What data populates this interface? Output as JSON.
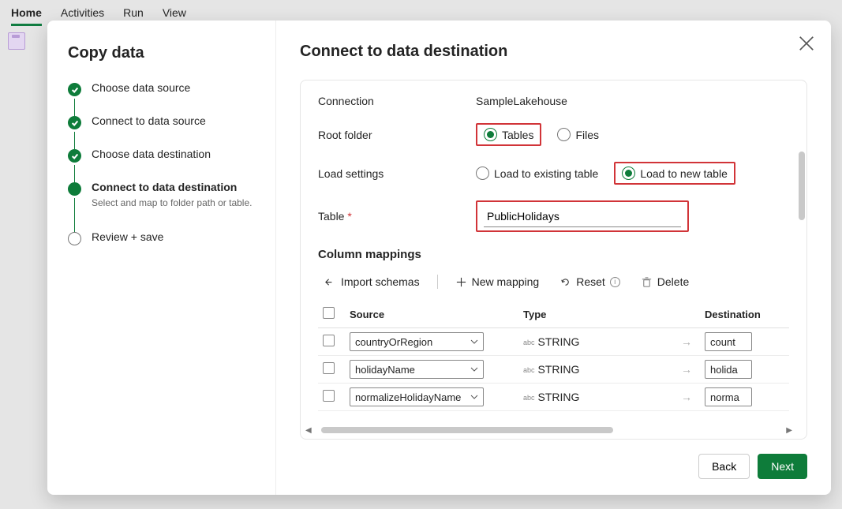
{
  "tabs": [
    "Home",
    "Activities",
    "Run",
    "View"
  ],
  "active_tab": 0,
  "wizard_title": "Copy data",
  "steps": [
    {
      "label": "Choose data source",
      "state": "done"
    },
    {
      "label": "Connect to data source",
      "state": "done"
    },
    {
      "label": "Choose data destination",
      "state": "done"
    },
    {
      "label": "Connect to data destination",
      "state": "current",
      "hint": "Select and map to folder path or table."
    },
    {
      "label": "Review + save",
      "state": "pending"
    }
  ],
  "panel": {
    "title": "Connect to data destination",
    "connection_label": "Connection",
    "connection_value": "SampleLakehouse",
    "root_folder_label": "Root folder",
    "root_folder_options": [
      "Tables",
      "Files"
    ],
    "root_folder_selected": "Tables",
    "load_settings_label": "Load settings",
    "load_options": [
      "Load to existing table",
      "Load to new table"
    ],
    "load_selected": "Load to new table",
    "table_label": "Table",
    "table_value": "PublicHolidays",
    "column_mappings_label": "Column mappings",
    "toolbar": {
      "import": "Import schemas",
      "new": "New mapping",
      "reset": "Reset",
      "delete": "Delete"
    },
    "columns_header": {
      "source": "Source",
      "type": "Type",
      "dest": "Destination"
    },
    "rows": [
      {
        "source": "countryOrRegion",
        "type": "STRING",
        "dest": "count"
      },
      {
        "source": "holidayName",
        "type": "STRING",
        "dest": "holida"
      },
      {
        "source": "normalizeHolidayName",
        "type": "STRING",
        "dest": "norma"
      }
    ],
    "back": "Back",
    "next": "Next"
  }
}
